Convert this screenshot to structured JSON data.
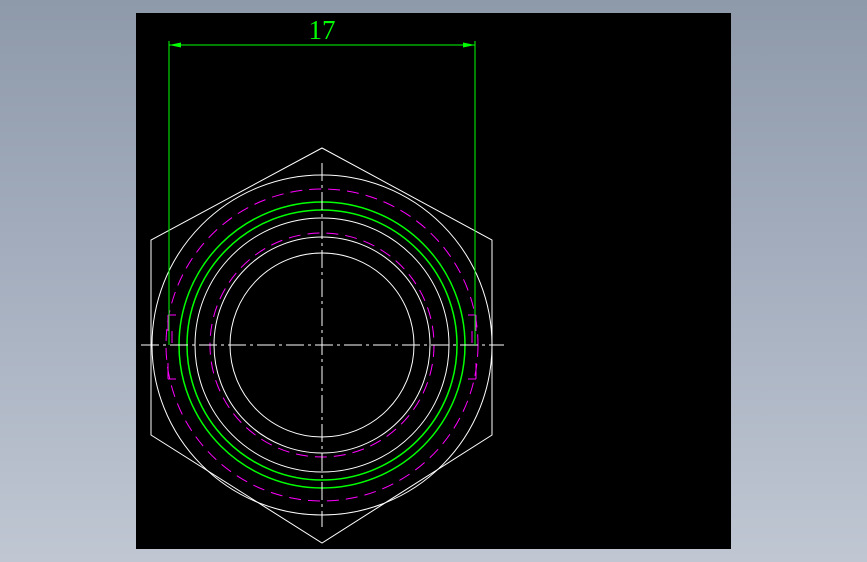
{
  "drawing": {
    "dimension_label": "17",
    "colors": {
      "background": "#000000",
      "geometry": "#ffffff",
      "dimension": "#00ff00",
      "thread": "#00ff00",
      "hidden": "#ff00ff",
      "centerline": "#ffffff"
    }
  }
}
